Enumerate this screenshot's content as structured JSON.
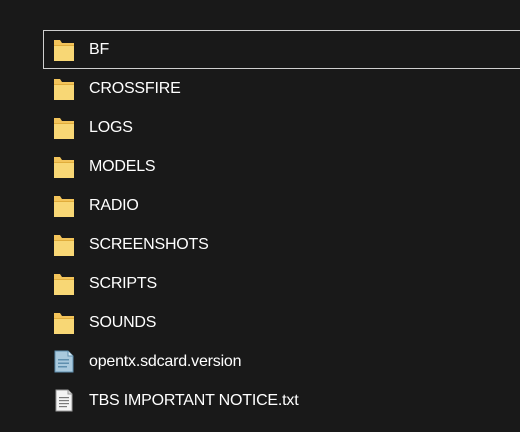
{
  "explorer": {
    "items": [
      {
        "name": "BF",
        "type": "folder",
        "icon": "folder-icon",
        "selected": true
      },
      {
        "name": "CROSSFIRE",
        "type": "folder",
        "icon": "folder-icon"
      },
      {
        "name": "LOGS",
        "type": "folder",
        "icon": "folder-icon"
      },
      {
        "name": "MODELS",
        "type": "folder",
        "icon": "folder-icon"
      },
      {
        "name": "RADIO",
        "type": "folder",
        "icon": "folder-icon"
      },
      {
        "name": "SCREENSHOTS",
        "type": "folder",
        "icon": "folder-icon"
      },
      {
        "name": "SCRIPTS",
        "type": "folder",
        "icon": "folder-icon"
      },
      {
        "name": "SOUNDS",
        "type": "folder",
        "icon": "folder-icon"
      },
      {
        "name": "opentx.sdcard.version",
        "type": "file",
        "icon": "version-file-icon"
      },
      {
        "name": "TBS IMPORTANT NOTICE.txt",
        "type": "file",
        "icon": "text-file-icon"
      }
    ]
  },
  "colors": {
    "background": "#191919",
    "text": "#ffffff",
    "folder": "#f3c45a",
    "selection_border": "#cfcfcf"
  }
}
